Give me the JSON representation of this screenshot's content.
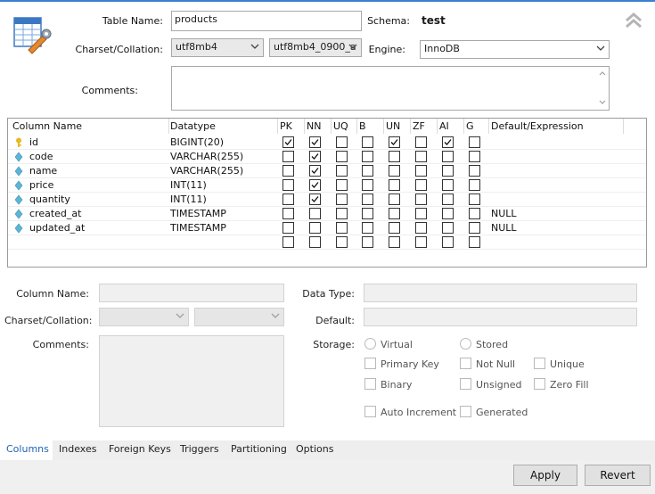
{
  "header": {
    "table_name_label": "Table Name:",
    "table_name_value": "products",
    "schema_label": "Schema:",
    "schema_value": "test",
    "charset_label": "Charset/Collation:",
    "charset_value": "utf8mb4",
    "collation_value": "utf8mb4_0900_a",
    "engine_label": "Engine:",
    "engine_value": "InnoDB",
    "comments_label": "Comments:"
  },
  "grid": {
    "columns": [
      "Column Name",
      "Datatype",
      "PK",
      "NN",
      "UQ",
      "B",
      "UN",
      "ZF",
      "AI",
      "G",
      "Default/Expression"
    ],
    "rows": [
      {
        "name": "id",
        "icon": "key-icon",
        "datatype": "BIGINT(20)",
        "pk": true,
        "nn": true,
        "uq": false,
        "b": false,
        "un": true,
        "zf": false,
        "ai": true,
        "g": false,
        "default": ""
      },
      {
        "name": "code",
        "icon": "diamond-icon",
        "datatype": "VARCHAR(255)",
        "pk": false,
        "nn": true,
        "uq": false,
        "b": false,
        "un": false,
        "zf": false,
        "ai": false,
        "g": false,
        "default": ""
      },
      {
        "name": "name",
        "icon": "diamond-icon",
        "datatype": "VARCHAR(255)",
        "pk": false,
        "nn": true,
        "uq": false,
        "b": false,
        "un": false,
        "zf": false,
        "ai": false,
        "g": false,
        "default": ""
      },
      {
        "name": "price",
        "icon": "diamond-icon",
        "datatype": "INT(11)",
        "pk": false,
        "nn": true,
        "uq": false,
        "b": false,
        "un": false,
        "zf": false,
        "ai": false,
        "g": false,
        "default": ""
      },
      {
        "name": "quantity",
        "icon": "diamond-icon",
        "datatype": "INT(11)",
        "pk": false,
        "nn": true,
        "uq": false,
        "b": false,
        "un": false,
        "zf": false,
        "ai": false,
        "g": false,
        "default": ""
      },
      {
        "name": "created_at",
        "icon": "diamond-icon",
        "datatype": "TIMESTAMP",
        "pk": false,
        "nn": false,
        "uq": false,
        "b": false,
        "un": false,
        "zf": false,
        "ai": false,
        "g": false,
        "default": "NULL"
      },
      {
        "name": "updated_at",
        "icon": "diamond-icon",
        "datatype": "TIMESTAMP",
        "pk": false,
        "nn": false,
        "uq": false,
        "b": false,
        "un": false,
        "zf": false,
        "ai": false,
        "g": false,
        "default": "NULL"
      },
      {
        "name": "",
        "icon": "",
        "datatype": "",
        "pk": false,
        "nn": false,
        "uq": false,
        "b": false,
        "un": false,
        "zf": false,
        "ai": false,
        "g": false,
        "default": ""
      }
    ]
  },
  "details": {
    "column_name_label": "Column Name:",
    "charset_label": "Charset/Collation:",
    "comments_label": "Comments:",
    "data_type_label": "Data Type:",
    "default_label": "Default:",
    "storage_label": "Storage:",
    "virtual_label": "Virtual",
    "stored_label": "Stored",
    "primary_key_label": "Primary Key",
    "not_null_label": "Not Null",
    "unique_label": "Unique",
    "binary_label": "Binary",
    "unsigned_label": "Unsigned",
    "zero_fill_label": "Zero Fill",
    "auto_increment_label": "Auto Increment",
    "generated_label": "Generated"
  },
  "tabs": [
    "Columns",
    "Indexes",
    "Foreign Keys",
    "Triggers",
    "Partitioning",
    "Options"
  ],
  "active_tab": "Columns",
  "buttons": {
    "apply": "Apply",
    "revert": "Revert"
  },
  "colors": {
    "accent": "#1e63b6",
    "key_icon": "#e8b923",
    "diamond_icon": "#5bb5d6"
  }
}
